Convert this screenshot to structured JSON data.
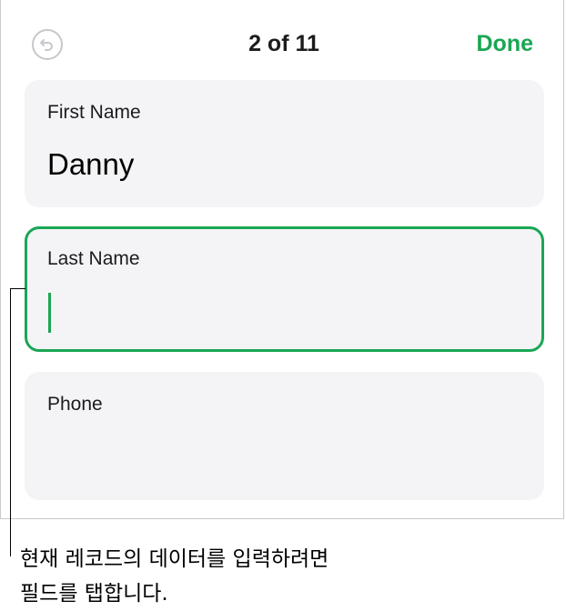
{
  "header": {
    "undo_icon": "undo-arrow-icon",
    "record_counter": "2 of 11",
    "done_label": "Done"
  },
  "fields": [
    {
      "label": "First Name",
      "value": "Danny",
      "active": false
    },
    {
      "label": "Last Name",
      "value": "",
      "active": true
    },
    {
      "label": "Phone",
      "value": "",
      "active": false
    }
  ],
  "colors": {
    "accent": "#1aa654",
    "card_background": "#f4f4f6",
    "undo_disabled": "#c7c7cc"
  },
  "callout": {
    "line1": "현재 레코드의 데이터를 입력하려면",
    "line2": "필드를 탭합니다."
  }
}
